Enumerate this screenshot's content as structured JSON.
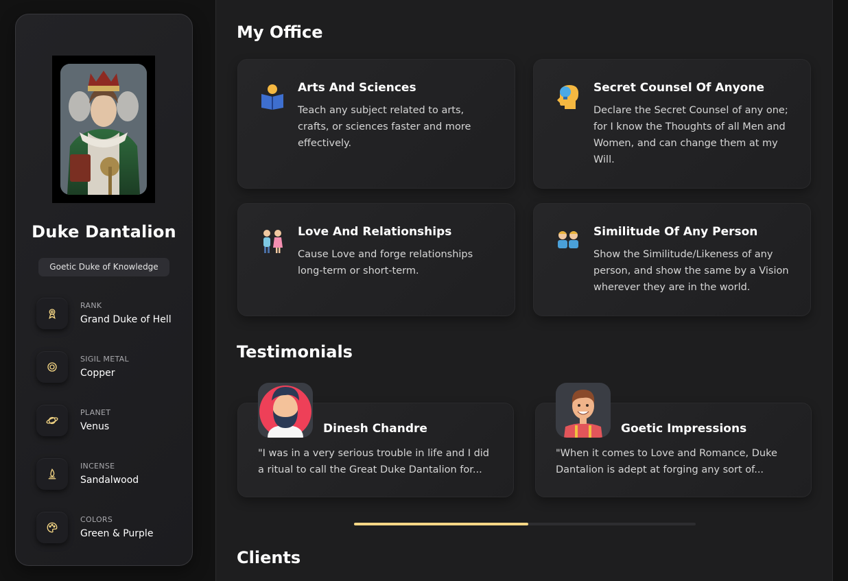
{
  "profile": {
    "name": "Duke Dantalion",
    "badge": "Goetic Duke of Knowledge",
    "info": [
      {
        "label": "RANK",
        "value": "Grand Duke of Hell",
        "icon": "award-icon"
      },
      {
        "label": "SIGIL METAL",
        "value": "Copper",
        "icon": "disc-icon"
      },
      {
        "label": "PLANET",
        "value": "Venus",
        "icon": "planet-icon"
      },
      {
        "label": "INCENSE",
        "value": "Sandalwood",
        "icon": "flame-icon"
      },
      {
        "label": "COLORS",
        "value": "Green & Purple",
        "icon": "palette-icon"
      }
    ]
  },
  "office": {
    "title": "My Office",
    "services": [
      {
        "title": "Arts And Sciences",
        "text": "Teach any subject related to arts, crafts, or sciences faster and more effectively.",
        "icon": "reading-book-icon"
      },
      {
        "title": "Secret Counsel Of Anyone",
        "text": "Declare the Secret Counsel of any one; for I know the Thoughts of all Men and Women, and can change them at my Will.",
        "icon": "head-idea-icon"
      },
      {
        "title": "Love And Relationships",
        "text": "Cause Love and forge relationships long-term or short-term.",
        "icon": "couple-icon"
      },
      {
        "title": "Similitude Of Any Person",
        "text": "Show the Similitude/Likeness of any person, and show the same by a Vision wherever they are in the world.",
        "icon": "twins-icon"
      }
    ]
  },
  "testimonials": {
    "title": "Testimonials",
    "items": [
      {
        "name": "Dinesh Chandre",
        "text": "\"I was in a very serious trouble in life and I did a ritual to call the Great Duke Dantalion for..."
      },
      {
        "name": "Goetic Impressions",
        "text": "\"When it comes to Love and Romance, Duke Dantalion is adept at forging any sort of..."
      }
    ],
    "progress": 0.51
  },
  "clients": {
    "title": "Clients"
  },
  "colors": {
    "accent": "#f6d785",
    "background": "#121212",
    "panel": "#1e1e1f"
  }
}
